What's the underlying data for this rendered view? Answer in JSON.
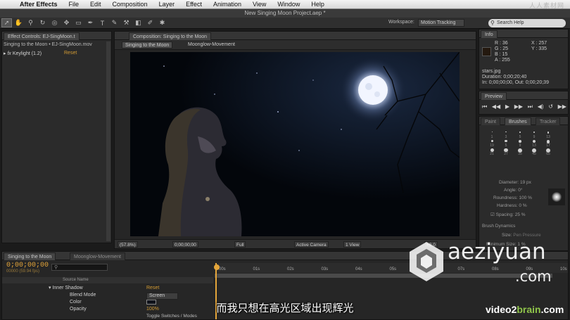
{
  "menubar": {
    "items": [
      "After Effects",
      "File",
      "Edit",
      "Composition",
      "Layer",
      "Effect",
      "Animation",
      "View",
      "Window",
      "Help"
    ],
    "watermark": "人人素材网"
  },
  "window_title": "New Singing Moon Project.aep *",
  "toolbar": {
    "workspace_label": "Workspace:",
    "workspace_value": "Motion Tracking",
    "search_placeholder": "Search Help"
  },
  "effect_controls": {
    "tab": "Effect Controls: EJ-SingMoon.t",
    "subtitle": "Singing to the Moon • EJ-SingMoon.mov",
    "effect_name": "Keylight (1.2)",
    "reset": "Reset"
  },
  "composition": {
    "tab": "Composition: Singing to the Moon",
    "sub_tabs": [
      "Singing to the Moon",
      "Moonglow-Movement"
    ],
    "zoom": "(57.8%)",
    "timecode": "0;00;00;00",
    "resolution": "Full",
    "camera": "Active Camera",
    "views": "1 View",
    "exposure": "+0.0"
  },
  "info": {
    "tab": "Info",
    "r": "R : 36",
    "g": "G : 25",
    "b": "B : 15",
    "a": "A : 255",
    "x": "X : 257",
    "y": "Y : 335",
    "file": "stars.jpg",
    "duration": "Duration: 0;00;20;40",
    "inout": "In: 0;00;00;00, Out: 0;00;20;39"
  },
  "preview": {
    "tab": "Preview"
  },
  "brushes": {
    "tabs": [
      "Paint",
      "Brushes",
      "Tracker"
    ],
    "sizes": [
      "1",
      "3",
      "5",
      "9",
      "13",
      "19",
      "5",
      "9",
      "13",
      "17",
      "21",
      "27",
      "35",
      "45",
      "65"
    ],
    "diameter": "Diameter: 19 px",
    "angle": "Angle: 0°",
    "roundness": "Roundness: 100 %",
    "hardness": "Hardness: 0 %",
    "spacing": "Spacing: 25 %",
    "dynamics": "Brush Dynamics",
    "size_label": "Size:",
    "size_value": "Pen Pressure",
    "min_size": "Minimum Size: 1 %"
  },
  "timeline": {
    "tabs": [
      "Singing to the Moon",
      "Moonglow-Movement"
    ],
    "time": "0;00;00;00",
    "fps": "00000 (59.94 fps)",
    "source_name_header": "Source Name",
    "rows": [
      {
        "label": "Inner Shadow",
        "value": "Reset"
      },
      {
        "label": "Blend Mode",
        "value": "Screen"
      },
      {
        "label": "Color",
        "value": ""
      },
      {
        "label": "Opacity",
        "value": "100%"
      }
    ],
    "ruler_ticks": [
      "00s",
      "01s",
      "02s",
      "03s",
      "04s",
      "05s",
      "06s",
      "07s",
      "08s",
      "09s",
      "10s"
    ],
    "toggle": "Toggle Switches / Modes"
  },
  "overlay": {
    "subtitle": "而我只想在高光区域出现辉光",
    "watermark_line1": "aeziyuan",
    "watermark_line2": ".com",
    "brand_a": "video2",
    "brand_b": "brain",
    "brand_c": ".com"
  }
}
